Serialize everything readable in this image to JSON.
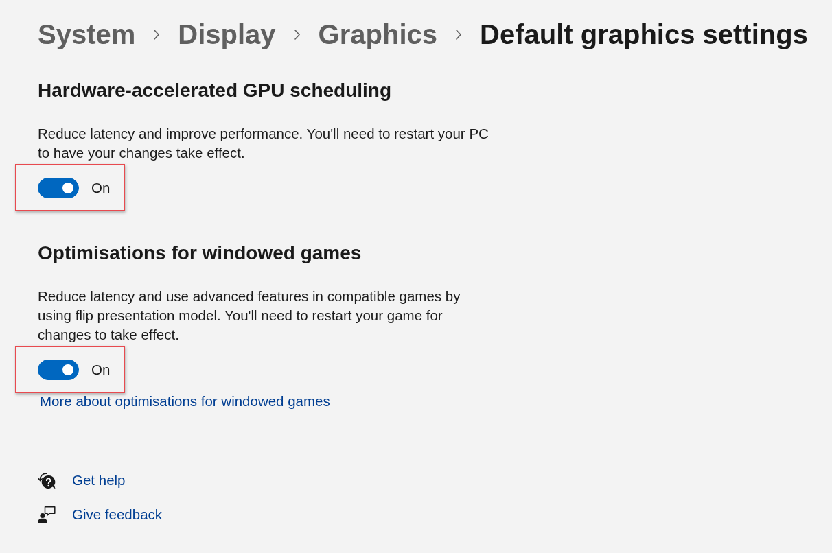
{
  "breadcrumb": [
    {
      "label": "System",
      "current": false
    },
    {
      "label": "Display",
      "current": false
    },
    {
      "label": "Graphics",
      "current": false
    },
    {
      "label": "Default graphics settings",
      "current": true
    }
  ],
  "settings": [
    {
      "title": "Hardware-accelerated GPU scheduling",
      "description": "Reduce latency and improve performance. You'll need to restart your PC to have your changes take effect.",
      "on": true,
      "state_label": "On",
      "highlighted": true
    },
    {
      "title": "Optimisations for windowed games",
      "description": "Reduce latency and use advanced features in compatible games by using flip presentation model. You'll need to restart your game for changes to take effect.",
      "on": true,
      "state_label": "On",
      "highlighted": true,
      "link": "More about optimisations for windowed games"
    }
  ],
  "help_links": [
    {
      "kind": "help",
      "label": "Get help"
    },
    {
      "kind": "feedback",
      "label": "Give feedback"
    }
  ]
}
